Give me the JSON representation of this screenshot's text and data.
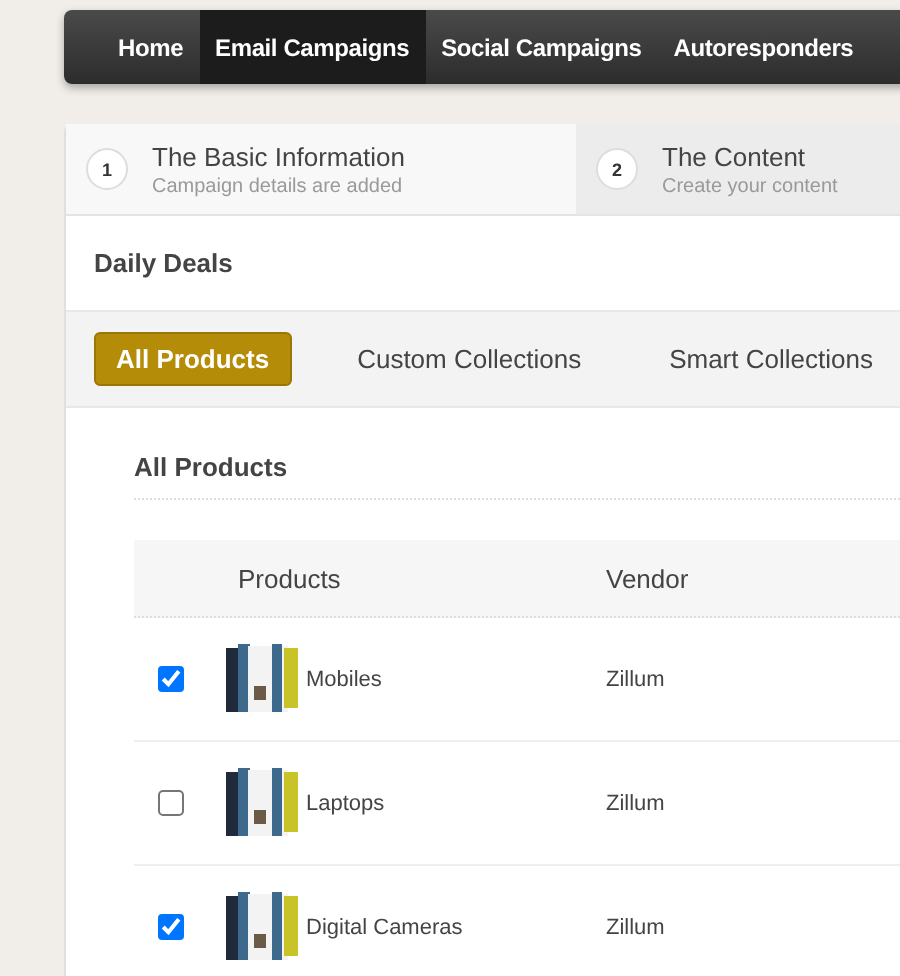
{
  "nav": [
    {
      "label": "Home",
      "selected": false
    },
    {
      "label": "Email Campaigns",
      "selected": true
    },
    {
      "label": "Social Campaigns",
      "selected": false
    },
    {
      "label": "Autoresponders",
      "selected": false
    }
  ],
  "steps": [
    {
      "number": "1",
      "title": "The Basic Information",
      "subtitle": "Campaign details are added",
      "selected": false
    },
    {
      "number": "2",
      "title": "The Content",
      "subtitle": "Create your content",
      "selected": true
    }
  ],
  "section_title": "Daily Deals",
  "tabs": [
    {
      "label": "All Products",
      "selected": true
    },
    {
      "label": "Custom Collections",
      "selected": false
    },
    {
      "label": "Smart Collections",
      "selected": false
    }
  ],
  "list_title": "All Products",
  "table": {
    "columns": [
      "Products",
      "Vendor"
    ],
    "rows": [
      {
        "checked": true,
        "product": "Mobiles",
        "vendor": "Zillum"
      },
      {
        "checked": false,
        "product": "Laptops",
        "vendor": "Zillum"
      },
      {
        "checked": true,
        "product": "Digital Cameras",
        "vendor": "Zillum"
      }
    ]
  }
}
